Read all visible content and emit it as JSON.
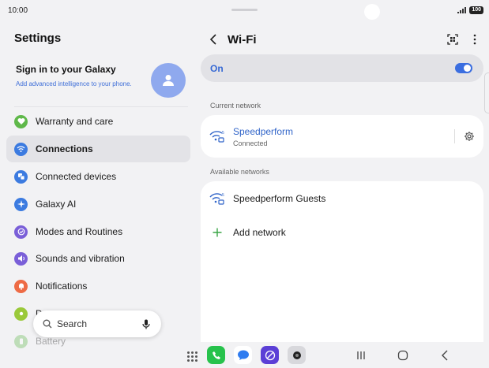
{
  "status": {
    "time": "10:00",
    "battery": "100"
  },
  "left": {
    "title": "Settings",
    "account": {
      "title": "Sign in to your Galaxy",
      "subtitle": "Add advanced intelligence to your phone."
    },
    "items": [
      {
        "label": "Warranty and care",
        "icon": "heart-icon",
        "color": "#5fb84a"
      },
      {
        "label": "Connections",
        "icon": "wifi-icon",
        "color": "#3c7be0",
        "active": true
      },
      {
        "label": "Connected devices",
        "icon": "devices-icon",
        "color": "#3c7be0"
      },
      {
        "label": "Galaxy AI",
        "icon": "sparkle-icon",
        "color": "#3c7be0"
      },
      {
        "label": "Modes and Routines",
        "icon": "check-circle-icon",
        "color": "#7a5fd8"
      },
      {
        "label": "Sounds and vibration",
        "icon": "speaker-icon",
        "color": "#7a5fd8"
      },
      {
        "label": "Notifications",
        "icon": "bell-icon",
        "color": "#ee6b45"
      },
      {
        "label": "D",
        "icon": "sun-icon",
        "color": "#9ac93a"
      },
      {
        "label": "Battery",
        "icon": "battery-icon",
        "color": "#5fb84a"
      }
    ],
    "search": {
      "label": "Search"
    }
  },
  "right": {
    "title": "Wi-Fi",
    "toggle_label": "On",
    "toggle_on": true,
    "current_header": "Current network",
    "current": {
      "name": "Speedperform",
      "status": "Connected"
    },
    "available_header": "Available networks",
    "available": [
      {
        "name": "Speedperform Guests"
      }
    ],
    "add_network": "Add network"
  },
  "colors": {
    "accent": "#3b6ee0",
    "background": "#f2f2f4"
  }
}
